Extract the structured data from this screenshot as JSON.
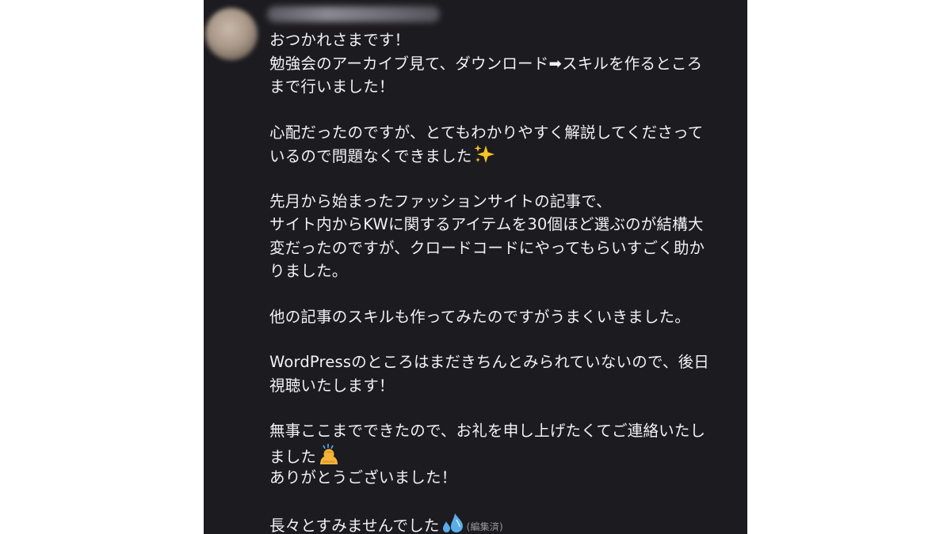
{
  "message": {
    "paragraphs": [
      [
        "おつかれさまです！",
        "勉強会のアーカイブ見て、ダウンロード➡スキルを作るところ",
        "まで行いました！"
      ],
      [
        "心配だったのですが、とてもわかりやすく解説してくださって",
        "いるので問題なくできました"
      ],
      [
        "先月から始まったファッションサイトの記事で、",
        "サイト内からKWに関するアイテムを30個ほど選ぶのが結構大",
        "変だったのですが、クロードコードにやってもらいすごく助か",
        "りました。"
      ],
      [
        "他の記事のスキルも作ってみたのですがうまくいきました。"
      ],
      [
        "WordPressのところはまだきちんとみられていないので、後日",
        "視聴いたします！"
      ],
      [
        "無事ここまでできたので、お礼を申し上げたくてご連絡いたし",
        "ました",
        "ありがとうございました！"
      ],
      [
        "長々とすみませんでした"
      ]
    ],
    "edited_label": "(編集済)"
  },
  "icons": {
    "sparkles": "sparkles-icon",
    "bowing_person": "bowing-person-icon",
    "sweat_droplets": "sweat-droplets-icon"
  },
  "colors": {
    "background": "#1c1b20",
    "text": "#f2f2f2",
    "sparkle": "#f7c325",
    "bow": "#f4b43a",
    "sweat": "#5aaee8"
  }
}
